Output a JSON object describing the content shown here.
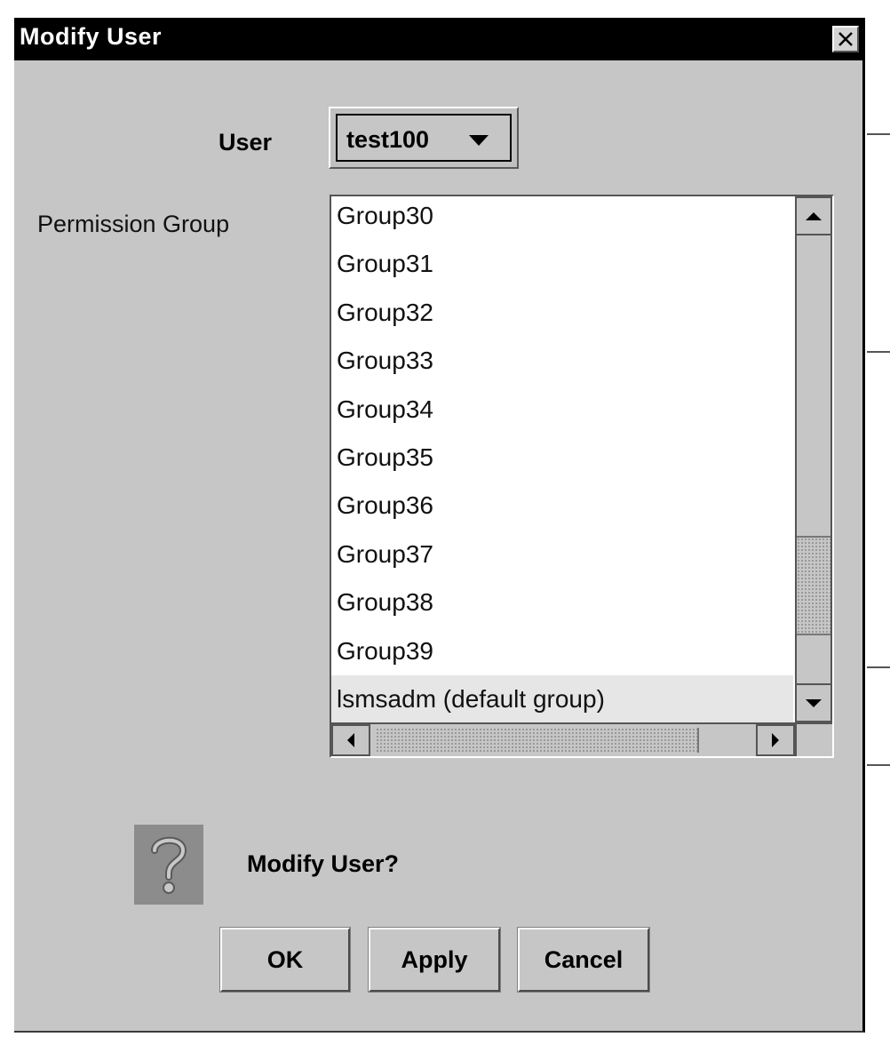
{
  "window": {
    "title": "Modify User",
    "close_icon": "close-icon"
  },
  "form": {
    "user_label": "User",
    "user_value": "test100",
    "permission_label": "Permission Group",
    "groups": [
      "Group30",
      "Group31",
      "Group32",
      "Group33",
      "Group34",
      "Group35",
      "Group36",
      "Group37",
      "Group38",
      "Group39",
      "lsmsadm (default group)"
    ],
    "selected_group": "lsmsadm (default group)"
  },
  "confirm": {
    "icon": "question-icon",
    "text": "Modify User?"
  },
  "buttons": {
    "ok": "OK",
    "apply": "Apply",
    "cancel": "Cancel"
  }
}
